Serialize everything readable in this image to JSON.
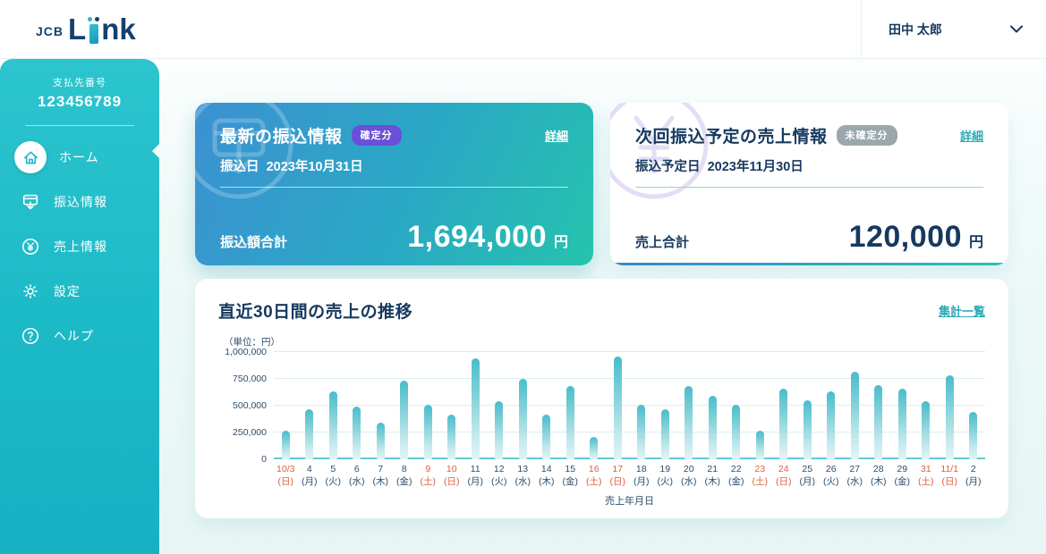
{
  "header": {
    "logo_jcb": "JCB",
    "logo_l": "L",
    "logo_nk": "nk",
    "user_name": "田中 太郎"
  },
  "sidebar": {
    "payer_label": "支払先番号",
    "payer_number": "123456789",
    "items": [
      {
        "label": "ホーム"
      },
      {
        "label": "振込情報"
      },
      {
        "label": "売上情報"
      },
      {
        "label": "設定"
      },
      {
        "label": "ヘルプ"
      }
    ]
  },
  "cards": {
    "latest_transfer": {
      "title": "最新の振込情報",
      "badge": "確定分",
      "detail_link": "詳細",
      "date_label": "振込日",
      "date": "2023年10月31日",
      "amount_label": "振込額合計",
      "amount": "1,694,000",
      "unit": "円"
    },
    "next_transfer": {
      "title": "次回振込予定の売上情報",
      "badge": "未確定分",
      "detail_link": "詳細",
      "date_label": "振込予定日",
      "date": "2023年11月30日",
      "amount_label": "売上合計",
      "amount": "120,000",
      "unit": "円"
    }
  },
  "chart_card": {
    "title": "直近30日間の売上の推移",
    "link": "集計一覧"
  },
  "chart_data": {
    "type": "bar",
    "title": "直近30日間の売上の推移",
    "unit_label": "（単位：円）",
    "xlabel": "売上年月日",
    "ylabel": "",
    "ylim": [
      0,
      1000000
    ],
    "grid": true,
    "yticks": [
      0,
      250000,
      500000,
      750000,
      1000000
    ],
    "ytick_labels": [
      "0",
      "250,000",
      "500,000",
      "750,000",
      "1,000,000"
    ],
    "categories": [
      {
        "day": "10/3",
        "weekday": "(日)",
        "holiday": true
      },
      {
        "day": "4",
        "weekday": "(月)",
        "holiday": false
      },
      {
        "day": "5",
        "weekday": "(火)",
        "holiday": false
      },
      {
        "day": "6",
        "weekday": "(水)",
        "holiday": false
      },
      {
        "day": "7",
        "weekday": "(木)",
        "holiday": false
      },
      {
        "day": "8",
        "weekday": "(金)",
        "holiday": false
      },
      {
        "day": "9",
        "weekday": "(土)",
        "holiday": true
      },
      {
        "day": "10",
        "weekday": "(日)",
        "holiday": true
      },
      {
        "day": "11",
        "weekday": "(月)",
        "holiday": false
      },
      {
        "day": "12",
        "weekday": "(火)",
        "holiday": false
      },
      {
        "day": "13",
        "weekday": "(水)",
        "holiday": false
      },
      {
        "day": "14",
        "weekday": "(木)",
        "holiday": false
      },
      {
        "day": "15",
        "weekday": "(金)",
        "holiday": false
      },
      {
        "day": "16",
        "weekday": "(土)",
        "holiday": true
      },
      {
        "day": "17",
        "weekday": "(日)",
        "holiday": true
      },
      {
        "day": "18",
        "weekday": "(月)",
        "holiday": false
      },
      {
        "day": "19",
        "weekday": "(火)",
        "holiday": false
      },
      {
        "day": "20",
        "weekday": "(水)",
        "holiday": false
      },
      {
        "day": "21",
        "weekday": "(木)",
        "holiday": false
      },
      {
        "day": "22",
        "weekday": "(金)",
        "holiday": false
      },
      {
        "day": "23",
        "weekday": "(土)",
        "holiday": true
      },
      {
        "day": "24",
        "weekday": "(日)",
        "holiday": true
      },
      {
        "day": "25",
        "weekday": "(月)",
        "holiday": false
      },
      {
        "day": "26",
        "weekday": "(火)",
        "holiday": false
      },
      {
        "day": "27",
        "weekday": "(水)",
        "holiday": false
      },
      {
        "day": "28",
        "weekday": "(木)",
        "holiday": false
      },
      {
        "day": "29",
        "weekday": "(金)",
        "holiday": false
      },
      {
        "day": "31",
        "weekday": "(土)",
        "holiday": true
      },
      {
        "day": "11/1",
        "weekday": "(日)",
        "holiday": true
      },
      {
        "day": "2",
        "weekday": "(月)",
        "holiday": false
      }
    ],
    "values": [
      270000,
      470000,
      630000,
      490000,
      340000,
      730000,
      510000,
      420000,
      940000,
      540000,
      750000,
      420000,
      680000,
      210000,
      960000,
      510000,
      470000,
      680000,
      590000,
      510000,
      270000,
      660000,
      550000,
      630000,
      820000,
      690000,
      660000,
      540000,
      780000,
      440000
    ]
  },
  "colors": {
    "sidebar_teal": "#1fbdc9",
    "navy_text": "#16395f",
    "badge_purple": "#6a50d8",
    "badge_gray": "#9aa7ad",
    "holiday_red": "#e05f38",
    "link_teal": "#2aa9b8",
    "card_gradient_start": "#3b91d2",
    "card_gradient_end": "#25c3ad",
    "bar_teal": "#49bccd"
  }
}
